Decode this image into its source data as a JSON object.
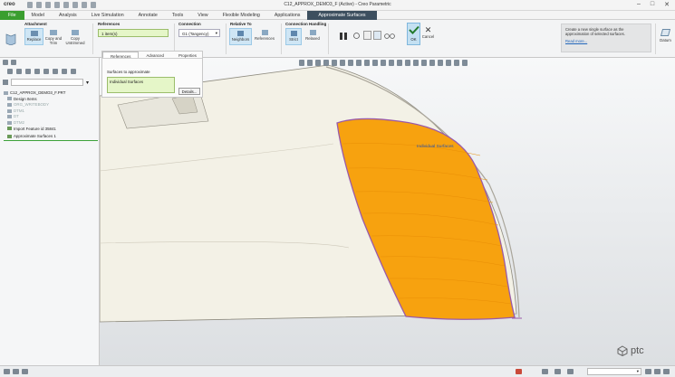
{
  "app": {
    "logo": "creo",
    "window_title": "C12_APPROX_DEMO3_F (Active) - Creo Parametric"
  },
  "tabs": [
    "File",
    "Model",
    "Analysis",
    "Live Simulation",
    "Annotate",
    "Tools",
    "View",
    "Flexible Modeling",
    "Applications",
    "Approximate Surfaces"
  ],
  "ribbon": {
    "attachment": {
      "title": "Attachment",
      "replace": "Replace",
      "copy_trim": "Copy and Trim",
      "copy_untrimmed": "Copy Untrimmed"
    },
    "references": {
      "title": "References",
      "value": "1 item(s)"
    },
    "connection": {
      "title": "Connection",
      "value": "G1 (Tangency)"
    },
    "relative_to": {
      "title": "Relative To",
      "neighbors": "Neighbors",
      "references": "References"
    },
    "connection_handling": {
      "title": "Connection Handling",
      "strict": "Strict",
      "relaxed": "Relaxed"
    },
    "ok": "OK",
    "cancel": "Cancel",
    "help_text": "Create a new single surface as the approximation of selected surfaces.",
    "read_more": "Read more...",
    "datum": "Datum"
  },
  "dashboard": {
    "tabs": [
      "References",
      "Advanced",
      "Properties"
    ],
    "surfaces_label": "Surfaces to approximate",
    "collector_value": "Individual Surfaces",
    "details_button": "Details..."
  },
  "tree": [
    {
      "label": "C12_APPROX_DEMO3_F.PRT",
      "dim": false,
      "green": false
    },
    {
      "label": "Design Items",
      "dim": false,
      "green": false
    },
    {
      "label": "ORG_WRITEBODY",
      "dim": true,
      "green": false
    },
    {
      "label": "DTM1",
      "dim": true,
      "green": false
    },
    {
      "label": "DT",
      "dim": true,
      "green": false
    },
    {
      "label": "DTM2",
      "dim": true,
      "green": false
    },
    {
      "label": "Import Feature id 35841",
      "dim": false,
      "green": true
    },
    {
      "label": "Approximate Surfaces 1",
      "dim": false,
      "green": true
    }
  ],
  "canvas": {
    "callout": "Individual Surfaces",
    "brand": "ptc"
  }
}
